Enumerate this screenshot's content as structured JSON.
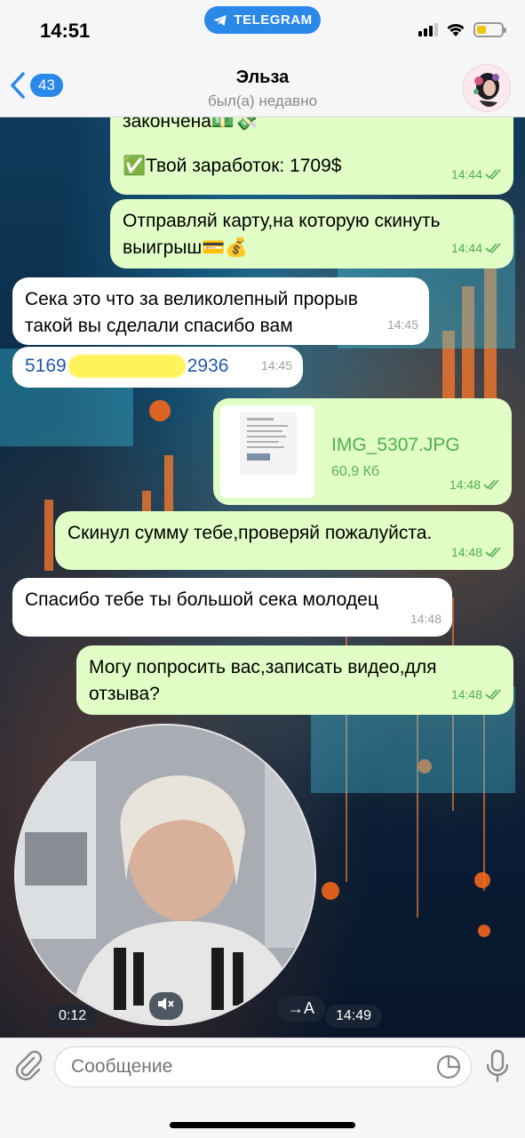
{
  "status_bar": {
    "time": "14:51",
    "pill_label": "TELEGRAM"
  },
  "header": {
    "back_count": "43",
    "contact_name": "Эльза",
    "contact_status": "был(а) недавно"
  },
  "messages": [
    {
      "id": "m1",
      "direction": "outgoing",
      "text_line1": "закончена💵💸",
      "text_line2": "✅Твой заработок: 1709$",
      "time": "14:44"
    },
    {
      "id": "m2",
      "direction": "outgoing",
      "text": "Отправляй карту,на которую скинуть выигрыш💳💰",
      "time": "14:44"
    },
    {
      "id": "m3",
      "direction": "incoming",
      "text": "Сека это что за великолепный прорыв такой вы сделали спасибо вам",
      "time": "14:45"
    },
    {
      "id": "m4",
      "direction": "incoming",
      "card_start": "5169",
      "card_end": "2936",
      "time": "14:45"
    },
    {
      "id": "m5",
      "direction": "outgoing",
      "file_name": "IMG_5307.JPG",
      "file_size": "60,9 Кб",
      "time": "14:48"
    },
    {
      "id": "m6",
      "direction": "outgoing",
      "text": "Скинул сумму тебе,проверяй пожалуйста.",
      "time": "14:48"
    },
    {
      "id": "m7",
      "direction": "incoming",
      "text": "Спасибо тебе ты большой сека молодец",
      "time": "14:48"
    },
    {
      "id": "m8",
      "direction": "outgoing",
      "text": "Могу попросить вас,записать видео,для отзыва?",
      "time": "14:48"
    }
  ],
  "video_message": {
    "duration": "0:12",
    "translate_label": "→A",
    "time": "14:49"
  },
  "input": {
    "placeholder": "Сообщение"
  },
  "colors": {
    "accent": "#2a88e8",
    "outgoing_bubble": "#e1fec6",
    "incoming_bubble": "#ffffff",
    "outgoing_meta": "#4fae4e"
  }
}
